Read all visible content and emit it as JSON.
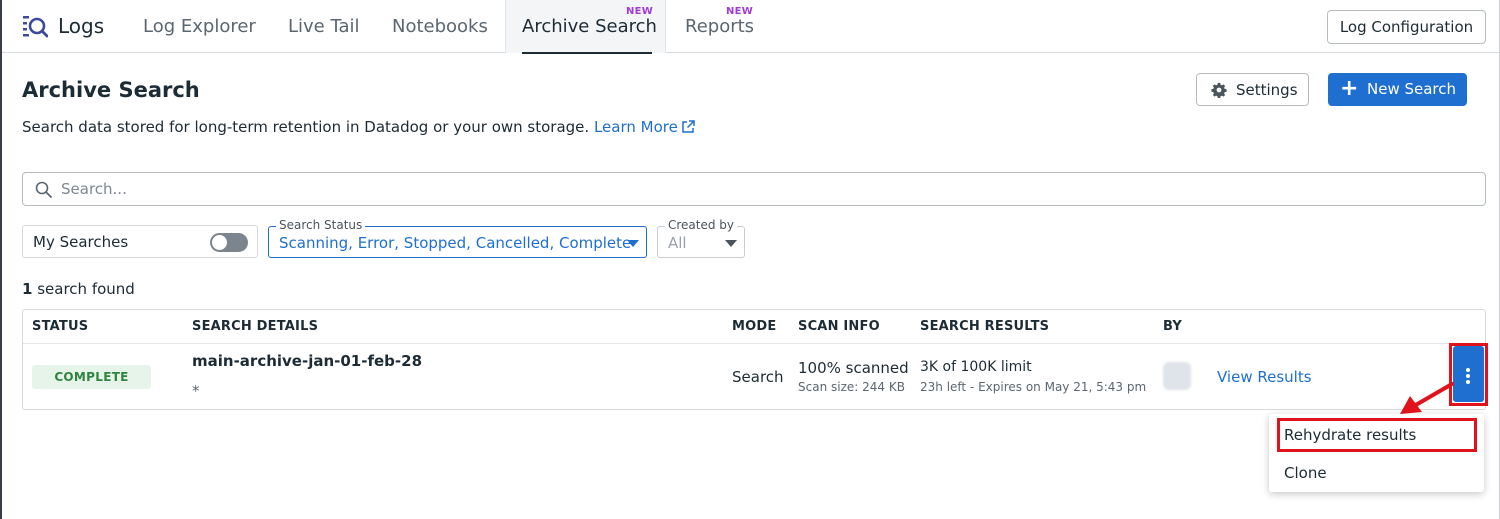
{
  "app": {
    "title": "Logs",
    "tabs": [
      {
        "label": "Log Explorer"
      },
      {
        "label": "Live Tail"
      },
      {
        "label": "Notebooks"
      },
      {
        "label": "Archive Search",
        "badge": "NEW",
        "active": true
      },
      {
        "label": "Reports",
        "badge": "NEW"
      }
    ],
    "log_config_label": "Log Configuration"
  },
  "header": {
    "title": "Archive Search",
    "subtitle": "Search data stored for long-term retention in Datadog or your own storage.",
    "learn_more": "Learn More",
    "settings_label": "Settings",
    "new_search_label": "New Search"
  },
  "search": {
    "placeholder": "Search..."
  },
  "filters": {
    "my_searches_label": "My Searches",
    "my_searches_enabled": false,
    "status_legend": "Search Status",
    "status_value": "Scanning, Error, Stopped, Cancelled, Complete",
    "created_legend": "Created by",
    "created_value": "All"
  },
  "results": {
    "count": "1",
    "count_suffix": "search found"
  },
  "table": {
    "columns": [
      "STATUS",
      "SEARCH DETAILS",
      "MODE",
      "SCAN INFO",
      "SEARCH RESULTS",
      "BY"
    ],
    "rows": [
      {
        "status": "COMPLETE",
        "name": "main-archive-jan-01-feb-28",
        "query": "*",
        "mode": "Search",
        "scan_main": "100% scanned",
        "scan_sub": "Scan size: 244 KB",
        "results_main": "3K of 100K limit",
        "results_sub": "23h left - Expires on May 21, 5:43 pm",
        "action": "View Results"
      }
    ]
  },
  "menu": {
    "items": [
      {
        "label": "Rehydrate results"
      },
      {
        "label": "Clone"
      }
    ]
  },
  "colors": {
    "accent": "#1e6fd0",
    "new_badge": "#a13bd6",
    "complete_text": "#2e8540",
    "complete_bg": "#e6f4ea",
    "annotation": "#e0121b"
  },
  "icons": [
    "logs-logo-icon",
    "external-link-icon",
    "gear-icon",
    "plus-icon",
    "search-icon",
    "chevron-down-icon",
    "kebab-menu-icon",
    "annotation-arrow-icon"
  ]
}
